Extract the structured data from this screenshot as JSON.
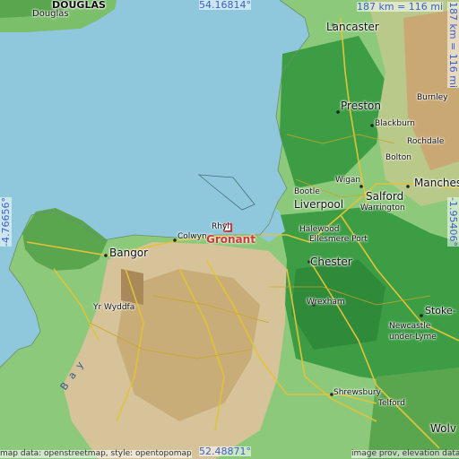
{
  "coordinates": {
    "top_lat": "54.16814°",
    "bottom_lat": "52.48871°",
    "left_lon": "-4.76656°",
    "right_lon": "-1.95406°"
  },
  "scale": {
    "top": "187 km = 116 mi",
    "right": "187 km = 116 mi"
  },
  "marker": {
    "name": "Gronant"
  },
  "places": {
    "douglas_caps": "DOUGLAS",
    "douglas": "Douglas",
    "lancaster": "Lancaster",
    "preston": "Preston",
    "burnley": "Burnley",
    "blackburn": "Blackburn",
    "rochdale": "Rochdale",
    "bolton": "Bolton",
    "bootle": "Bootle",
    "wigan": "Wigan",
    "salford": "Salford",
    "manchester": "Manchester",
    "liverpool": "Liverpool",
    "warrington": "Warrington",
    "halewood": "Halewood",
    "ellesmere_port": "Ellesmere Port",
    "chester": "Chester",
    "wrexham": "Wrexham",
    "stoke": "Stoke-",
    "newcastle": "Newcastle",
    "under_lyme": "under-Lyme",
    "shrewsbury": "Shrewsbury",
    "telford": "Telford",
    "bangor": "Bangor",
    "colwyn_bay": "Colwyn",
    "rhyl": "Rhyl",
    "yr_wyddfa": "Yr Wyddfa",
    "bay_text": "B a y",
    "wolverhampton": "Wolv"
  },
  "credits": {
    "left": "map data: openstreetmap, style: opentopomap",
    "right": "image prov, elevation data"
  }
}
